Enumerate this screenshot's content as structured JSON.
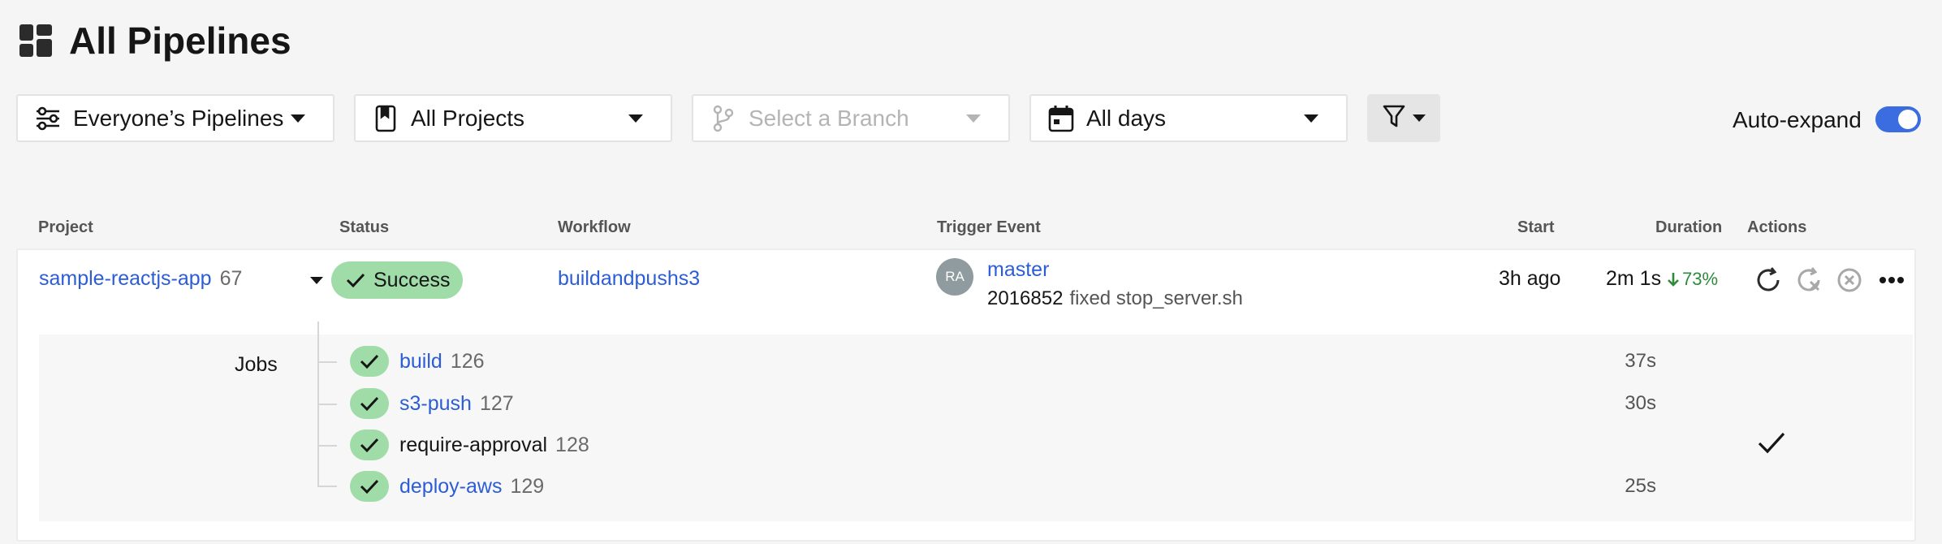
{
  "page": {
    "title": "All Pipelines"
  },
  "filters": {
    "pipelines": {
      "label": "Everyone’s Pipelines"
    },
    "projects": {
      "label": "All Projects"
    },
    "branch": {
      "placeholder": "Select a Branch"
    },
    "days": {
      "label": "All days"
    }
  },
  "auto_expand": {
    "label": "Auto-expand",
    "enabled": true
  },
  "table": {
    "headers": {
      "project": "Project",
      "status": "Status",
      "workflow": "Workflow",
      "trigger": "Trigger Event",
      "start": "Start",
      "duration": "Duration",
      "actions": "Actions"
    },
    "row": {
      "project": "sample-reactjs-app",
      "pipeline_number": "67",
      "status": "Success",
      "workflow": "buildandpushs3",
      "avatar_initials": "RA",
      "branch": "master",
      "commit_sha": "2016852",
      "commit_message": "fixed stop_server.sh",
      "start": "3h ago",
      "duration": "2m 1s",
      "duration_change": "73%"
    },
    "jobs_label": "Jobs",
    "jobs": [
      {
        "name": "build",
        "number": "126",
        "duration": "37s",
        "linked": true
      },
      {
        "name": "s3-push",
        "number": "127",
        "duration": "30s",
        "linked": true
      },
      {
        "name": "require-approval",
        "number": "128",
        "duration": "",
        "linked": false
      },
      {
        "name": "deploy-aws",
        "number": "129",
        "duration": "25s",
        "linked": true
      }
    ]
  },
  "colors": {
    "link": "#2c5dd6",
    "success": "#9fdca8",
    "toggle": "#3b6de0",
    "improvement": "#2f8a3c"
  },
  "icons": {
    "page": "dashboard-grid-icon",
    "pipelines": "pipelines-sliders-icon",
    "projects": "bookmark-icon",
    "branch": "git-branch-icon",
    "days": "calendar-icon",
    "filter": "filter-funnel-icon",
    "rerun": "rerun-icon",
    "rerun_failed": "rerun-failed-icon",
    "cancel": "cancel-circle-icon",
    "more": "more-dots-icon"
  }
}
